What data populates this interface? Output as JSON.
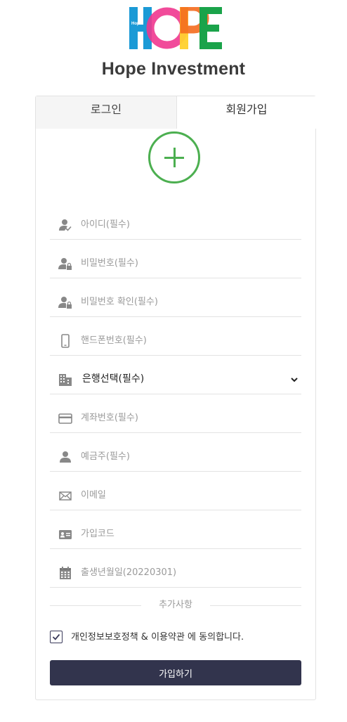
{
  "brand": {
    "logo_text": "HOPE",
    "logo_small": "Hope",
    "name": "Hope Investment"
  },
  "tabs": [
    {
      "label": "로그인"
    },
    {
      "label": "회원가입"
    }
  ],
  "fields": {
    "user_id": {
      "placeholder": "아이디(필수)",
      "icon": "user-check-icon"
    },
    "password": {
      "placeholder": "비밀번호(필수)",
      "icon": "user-lock-icon"
    },
    "password_confirm": {
      "placeholder": "비밀번호 확인(필수)",
      "icon": "user-lock-icon"
    },
    "phone": {
      "placeholder": "핸드폰번호(필수)",
      "icon": "smartphone-icon"
    },
    "bank": {
      "selected": "은행선택(필수)",
      "icon": "building-icon"
    },
    "account_number": {
      "placeholder": "계좌번호(필수)",
      "icon": "credit-card-icon"
    },
    "account_holder": {
      "placeholder": "예금주(필수)",
      "icon": "person-icon"
    },
    "email": {
      "placeholder": "이메일",
      "icon": "envelope-icon"
    },
    "join_code": {
      "placeholder": "가입코드",
      "icon": "id-card-icon"
    },
    "birthdate": {
      "placeholder": "출생년월일(20220301)",
      "icon": "calendar-icon"
    }
  },
  "extra_section": {
    "label": "추가사항"
  },
  "agreement": {
    "text": "개인정보보호정책 & 이용약관 에 동의합니다.",
    "checked": true
  },
  "submit": {
    "label": "가입하기"
  },
  "colors": {
    "accent_green": "#4caf50",
    "button_dark": "#32344d"
  }
}
